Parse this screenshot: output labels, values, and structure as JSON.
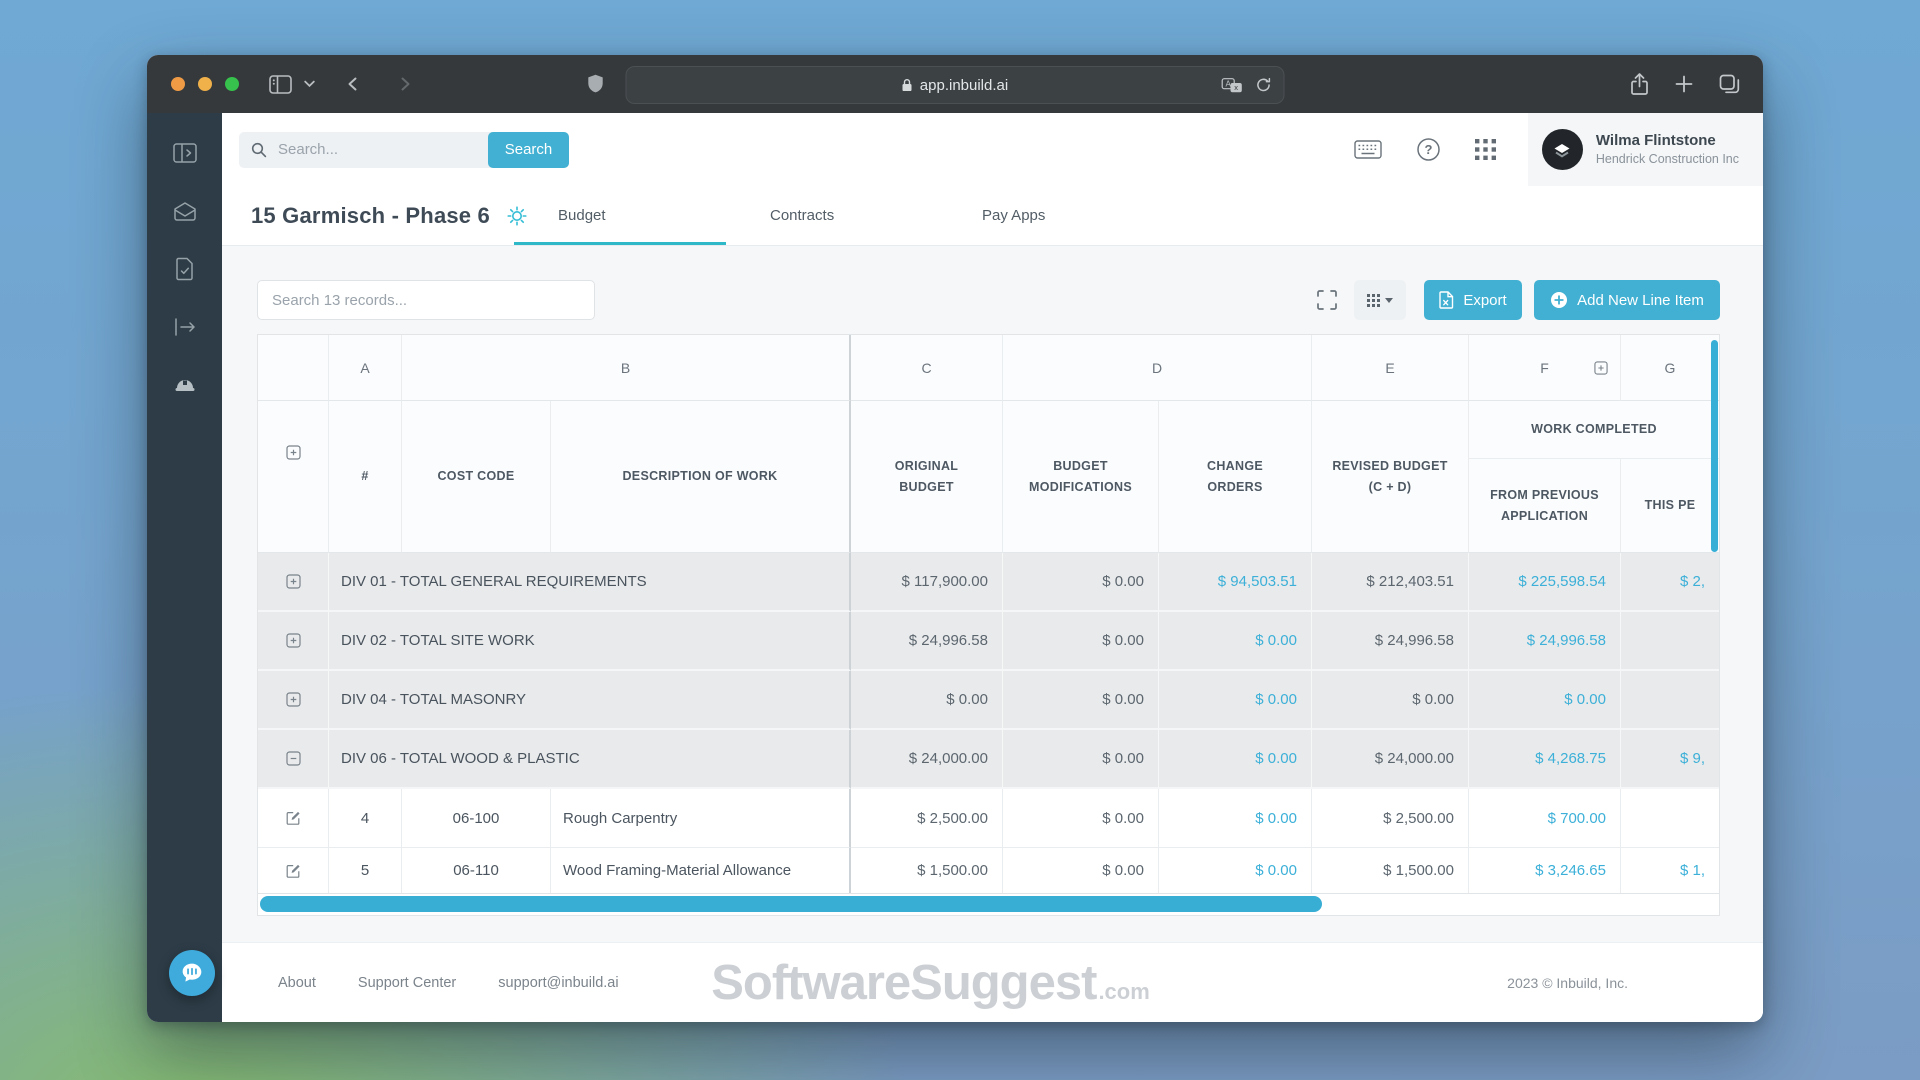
{
  "browser": {
    "url": "app.inbuild.ai"
  },
  "topbar": {
    "search_placeholder": "Search...",
    "search_button": "Search",
    "user": {
      "name": "Wilma Flintstone",
      "company": "Hendrick Construction Inc"
    }
  },
  "page": {
    "title": "15 Garmisch - Phase 6",
    "tabs": [
      {
        "label": "Budget",
        "active": true
      },
      {
        "label": "Contracts",
        "active": false
      },
      {
        "label": "Pay Apps",
        "active": false
      }
    ]
  },
  "toolbar": {
    "records_placeholder": "Search 13 records...",
    "export_label": "Export",
    "add_label": "Add New Line Item"
  },
  "table": {
    "letters": [
      "A",
      "B",
      "C",
      "D",
      "E",
      "F",
      "G"
    ],
    "headers": {
      "num": "#",
      "cost_code": "COST CODE",
      "description": "DESCRIPTION OF WORK",
      "original_budget": "ORIGINAL BUDGET",
      "budget_modifications": "BUDGET MODIFICATIONS",
      "change_orders": "CHANGE ORDERS",
      "revised_budget": "REVISED BUDGET (C + D)",
      "work_completed": "WORK COMPLETED",
      "from_previous_application": "FROM PREVIOUS APPLICATION",
      "this_period": "THIS PE"
    },
    "rows": [
      {
        "type": "group",
        "expanded": false,
        "label": "DIV 01 - TOTAL GENERAL REQUIREMENTS",
        "values": [
          {
            "text": "$ 117,900.00",
            "teal": false
          },
          {
            "text": "$ 0.00",
            "teal": false
          },
          {
            "text": "$ 94,503.51",
            "teal": true
          },
          {
            "text": "$ 212,403.51",
            "teal": false
          },
          {
            "text": "$ 225,598.54",
            "teal": true
          },
          {
            "text": "$ 2,",
            "teal": true
          }
        ]
      },
      {
        "type": "group",
        "expanded": false,
        "label": "DIV 02 - TOTAL SITE WORK",
        "values": [
          {
            "text": "$ 24,996.58",
            "teal": false
          },
          {
            "text": "$ 0.00",
            "teal": false
          },
          {
            "text": "$ 0.00",
            "teal": true
          },
          {
            "text": "$ 24,996.58",
            "teal": false
          },
          {
            "text": "$ 24,996.58",
            "teal": true
          },
          {
            "text": "",
            "teal": false
          }
        ]
      },
      {
        "type": "group",
        "expanded": false,
        "label": "DIV 04 - TOTAL MASONRY",
        "values": [
          {
            "text": "$ 0.00",
            "teal": false
          },
          {
            "text": "$ 0.00",
            "teal": false
          },
          {
            "text": "$ 0.00",
            "teal": true
          },
          {
            "text": "$ 0.00",
            "teal": false
          },
          {
            "text": "$ 0.00",
            "teal": true
          },
          {
            "text": "",
            "teal": false
          }
        ]
      },
      {
        "type": "group",
        "expanded": true,
        "label": "DIV 06 - TOTAL WOOD & PLASTIC",
        "values": [
          {
            "text": "$ 24,000.00",
            "teal": false
          },
          {
            "text": "$ 0.00",
            "teal": false
          },
          {
            "text": "$ 0.00",
            "teal": true
          },
          {
            "text": "$ 24,000.00",
            "teal": false
          },
          {
            "text": "$ 4,268.75",
            "teal": true
          },
          {
            "text": "$ 9,",
            "teal": true
          }
        ]
      },
      {
        "type": "item",
        "num": "4",
        "code": "06-100",
        "desc": "Rough Carpentry",
        "values": [
          {
            "text": "$ 2,500.00",
            "teal": false
          },
          {
            "text": "$ 0.00",
            "teal": false
          },
          {
            "text": "$ 0.00",
            "teal": true
          },
          {
            "text": "$ 2,500.00",
            "teal": false
          },
          {
            "text": "$ 700.00",
            "teal": true
          },
          {
            "text": "",
            "teal": false
          }
        ]
      },
      {
        "type": "item",
        "num": "5",
        "code": "06-110",
        "desc": "Wood Framing-Material Allowance",
        "values": [
          {
            "text": "$ 1,500.00",
            "teal": false
          },
          {
            "text": "$ 0.00",
            "teal": false
          },
          {
            "text": "$ 0.00",
            "teal": true
          },
          {
            "text": "$ 1,500.00",
            "teal": false
          },
          {
            "text": "$ 3,246.65",
            "teal": true
          },
          {
            "text": "$ 1,",
            "teal": true
          }
        ]
      }
    ]
  },
  "footer": {
    "links": [
      "About",
      "Support Center",
      "support@inbuild.ai"
    ],
    "watermark": "SoftwareSuggest",
    "watermark_suffix": ".com",
    "copyright": "2023 © Inbuild, Inc."
  },
  "colors": {
    "accent_teal": "#41b0d2",
    "teal_value_text": "#3cb0d8",
    "tab_underline": "#2fb9c8",
    "sidebar_bg": "#2d3c47",
    "group_row_bg": "#e9eaeb"
  }
}
